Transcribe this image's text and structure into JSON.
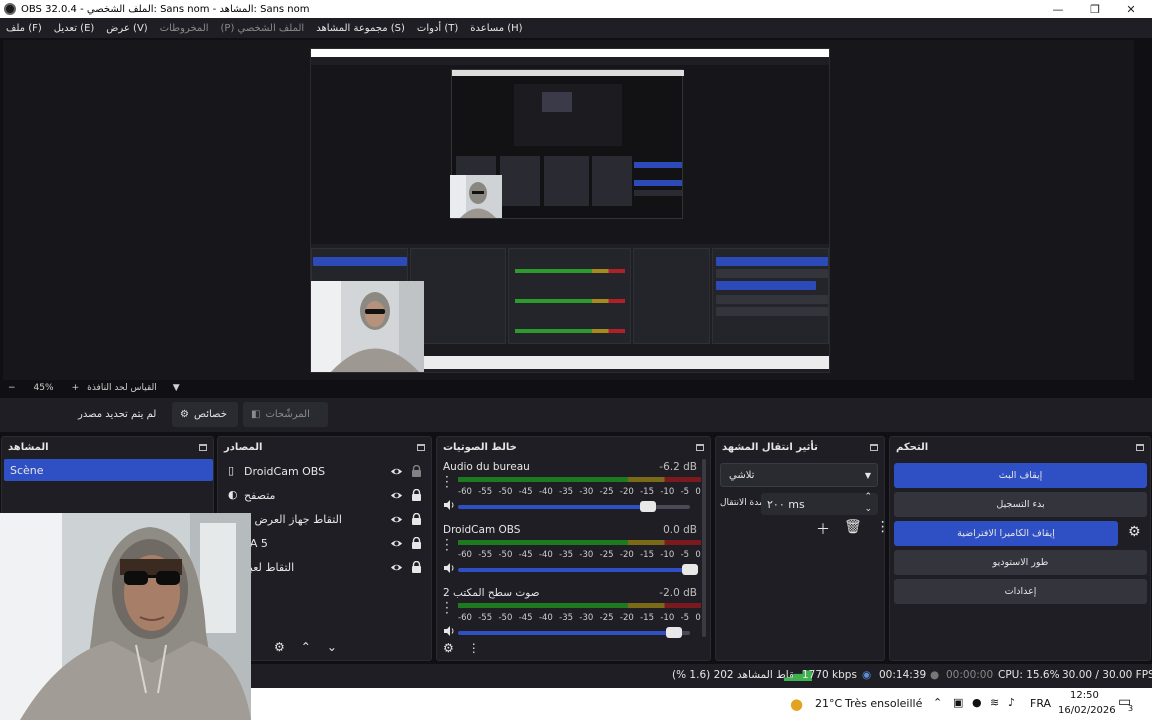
{
  "window": {
    "title": "OBS 32.0.4 - الملف الشخصي: Sans nom - المشاهد: Sans nom"
  },
  "menu": [
    {
      "label": "ملف (F)",
      "enabled": true
    },
    {
      "label": "تعديل (E)",
      "enabled": true
    },
    {
      "label": "عرض (V)",
      "enabled": true
    },
    {
      "label": "المخروطات",
      "enabled": false
    },
    {
      "label": "(P) الملف الشخصي",
      "enabled": false
    },
    {
      "label": "مجموعة المشاهد (S)",
      "enabled": true
    },
    {
      "label": "أدوات (T)",
      "enabled": true
    },
    {
      "label": "مساعدة (H)",
      "enabled": true
    }
  ],
  "zoom": {
    "minus": "−",
    "value": "45%",
    "plus": "+",
    "fit_label": "القياس لحد النافذة"
  },
  "context": {
    "no_source": "لم يتم تحديد مصدر",
    "properties": "خصائص",
    "filters": "المرشّحات"
  },
  "docks": {
    "scenes": {
      "title": "المشاهد",
      "items": [
        "Scène"
      ]
    },
    "sources": {
      "title": "المصادر",
      "items": [
        {
          "name": "DroidCam OBS"
        },
        {
          "name": "متصفح"
        },
        {
          "name": "التقاط جهاز العرض 2"
        },
        {
          "name": "TA 5"
        },
        {
          "name": "التقاط لعبة"
        }
      ]
    },
    "mixer": {
      "title": "خالط الصوتيات",
      "scale": [
        "-60",
        "-55",
        "-50",
        "-45",
        "-40",
        "-35",
        "-30",
        "-25",
        "-20",
        "-15",
        "-10",
        "-5",
        "0"
      ],
      "channels": [
        {
          "name": "Audio du bureau",
          "db": "-6.2 dB",
          "level": 0.82
        },
        {
          "name": "DroidCam OBS",
          "db": "0.0 dB",
          "level": 1.0
        },
        {
          "name": "صوت سطح المكتب 2",
          "db": "-2.0 dB",
          "level": 0.93
        }
      ]
    },
    "transitions": {
      "title": "تأثير انتقال المشهد",
      "type": "تلاشي",
      "duration_label": "مدة الانتقال",
      "duration_value": "٢٠٠ ms"
    },
    "controls": {
      "title": "التحكم",
      "buttons": [
        "إيقاف البث",
        "بدء التسجيل",
        "إيقاف الكاميرا الافتراضية",
        "طور الاستوديو",
        "إعدادات"
      ]
    }
  },
  "status": {
    "dropped": "إسقاط المشاهد 202 (1.6 %)",
    "bitrate": "1770 kbps",
    "stream_time": "00:14:39",
    "rec_time": "00:00:00",
    "cpu": "CPU: 15.6%",
    "fps": "30.00 / 30.00 FPS"
  },
  "taskbar": {
    "weather_temp": "21°C",
    "weather_text": "Très ensoleillé",
    "lang": "FRA",
    "time": "12:50",
    "date": "16/02/2026",
    "notif_count": "3"
  }
}
